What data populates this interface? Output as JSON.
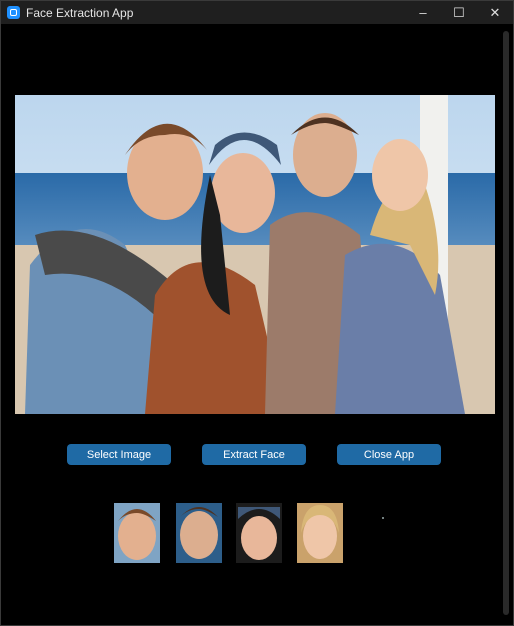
{
  "window": {
    "title": "Face Extraction App",
    "controls": [
      "–",
      "☐",
      "✕"
    ]
  },
  "buttons": {
    "select": "Select Image",
    "extract": "Extract Face",
    "close": "Close App"
  },
  "icons": {
    "app": "app-logo-icon",
    "minimize": "minimize-icon",
    "maximize": "maximize-icon",
    "close": "close-window-icon"
  },
  "colors": {
    "accent": "#1f6aa5",
    "background": "#000000",
    "titlebar": "#1f1f1f"
  }
}
